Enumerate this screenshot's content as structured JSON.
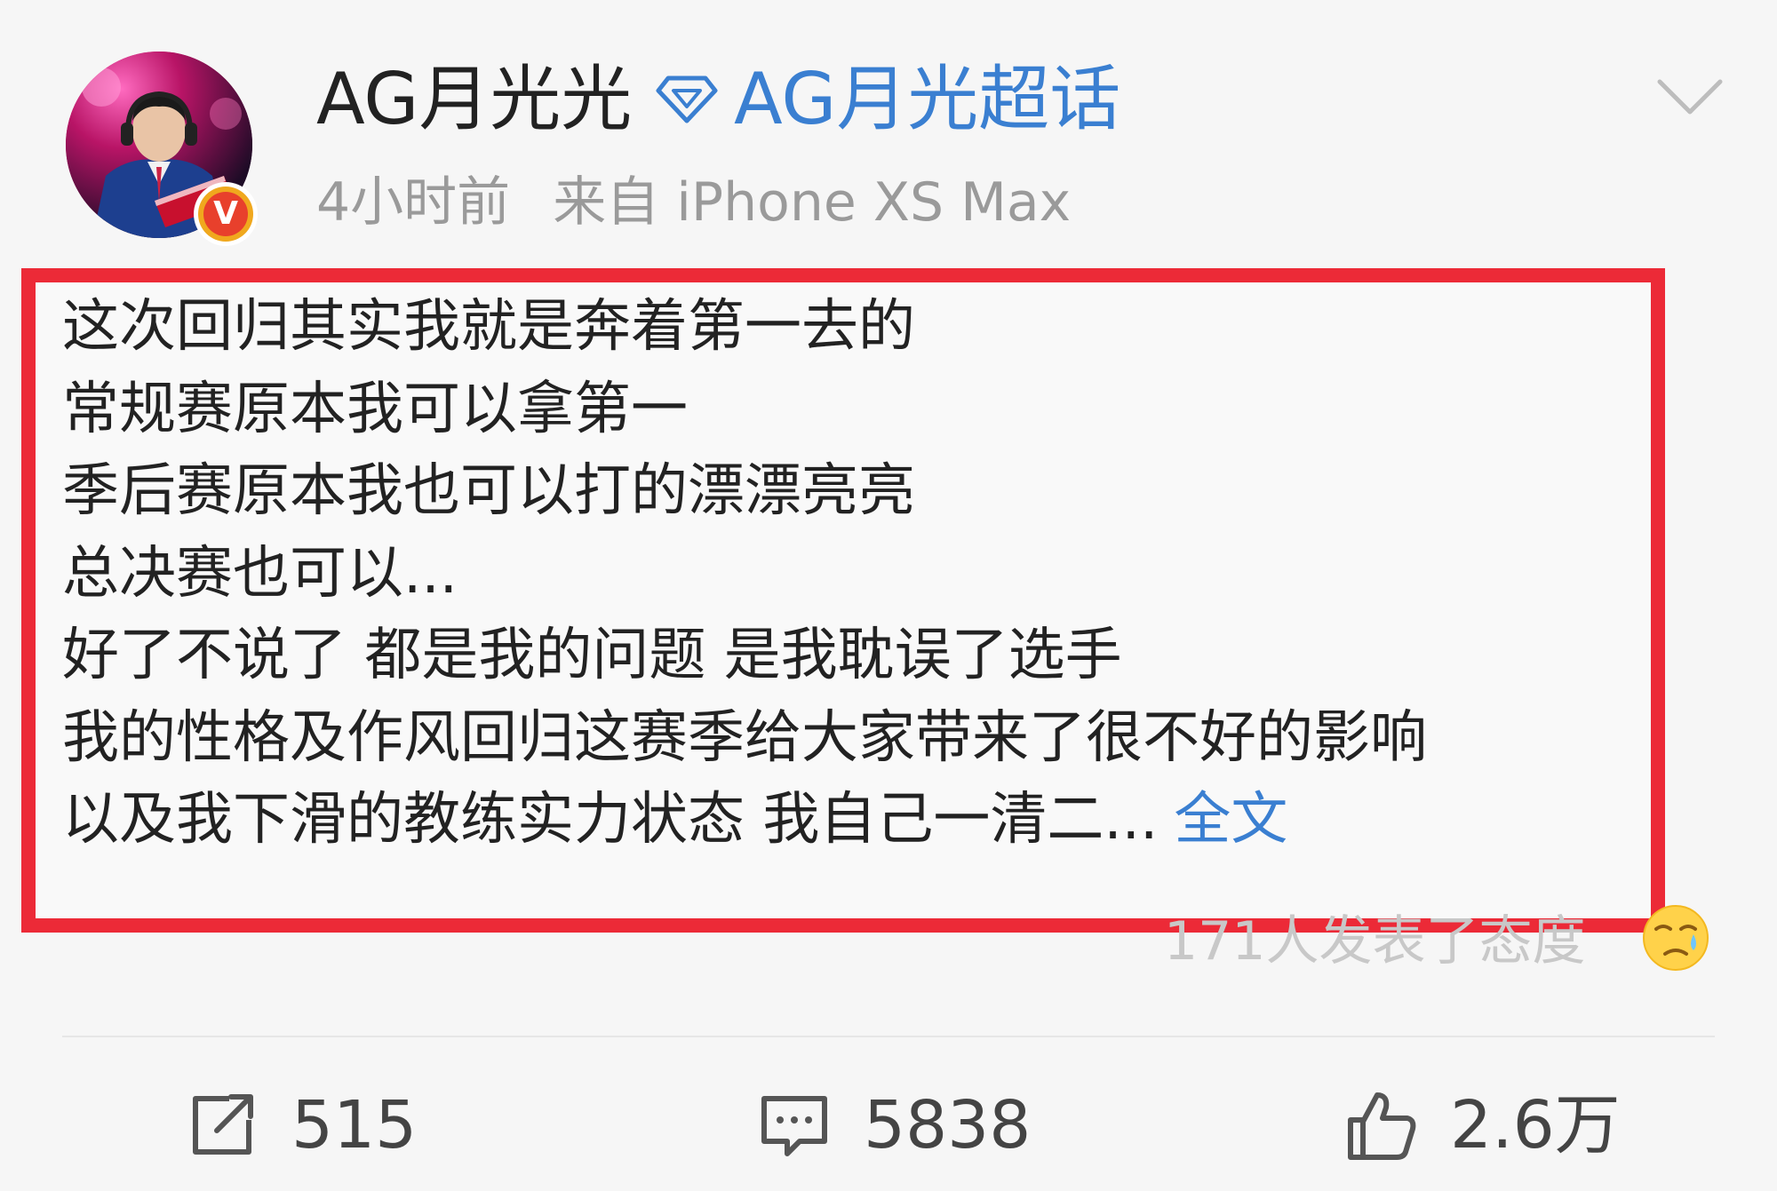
{
  "header": {
    "username": "AG月光光",
    "supertopic_label": "AG月光超话",
    "time": "4小时前",
    "source": "来自 iPhone XS Max",
    "verified_mark": "V"
  },
  "post": {
    "lines": [
      "这次回归其实我就是奔着第一去的",
      "常规赛原本我可以拿第一",
      "季后赛原本我也可以打的漂漂亮亮",
      "总决赛也可以...",
      "好了不说了 都是我的问题 是我耽误了选手",
      "我的性格及作风回归这赛季给大家带来了很不好的影响",
      "以及我下滑的教练实力状态 我自己一清二..."
    ],
    "full_text_link": "全文"
  },
  "attitude": {
    "text": "171人发表了态度",
    "emoji_icon": "sad-crying-face-icon"
  },
  "actions": {
    "repost_count": "515",
    "comment_count": "5838",
    "like_count": "2.6万"
  },
  "colors": {
    "highlight_border": "#ec2a37",
    "link_blue": "#3a7fd1",
    "meta_gray": "#9a9a9a",
    "background": "#f6f6f6"
  }
}
